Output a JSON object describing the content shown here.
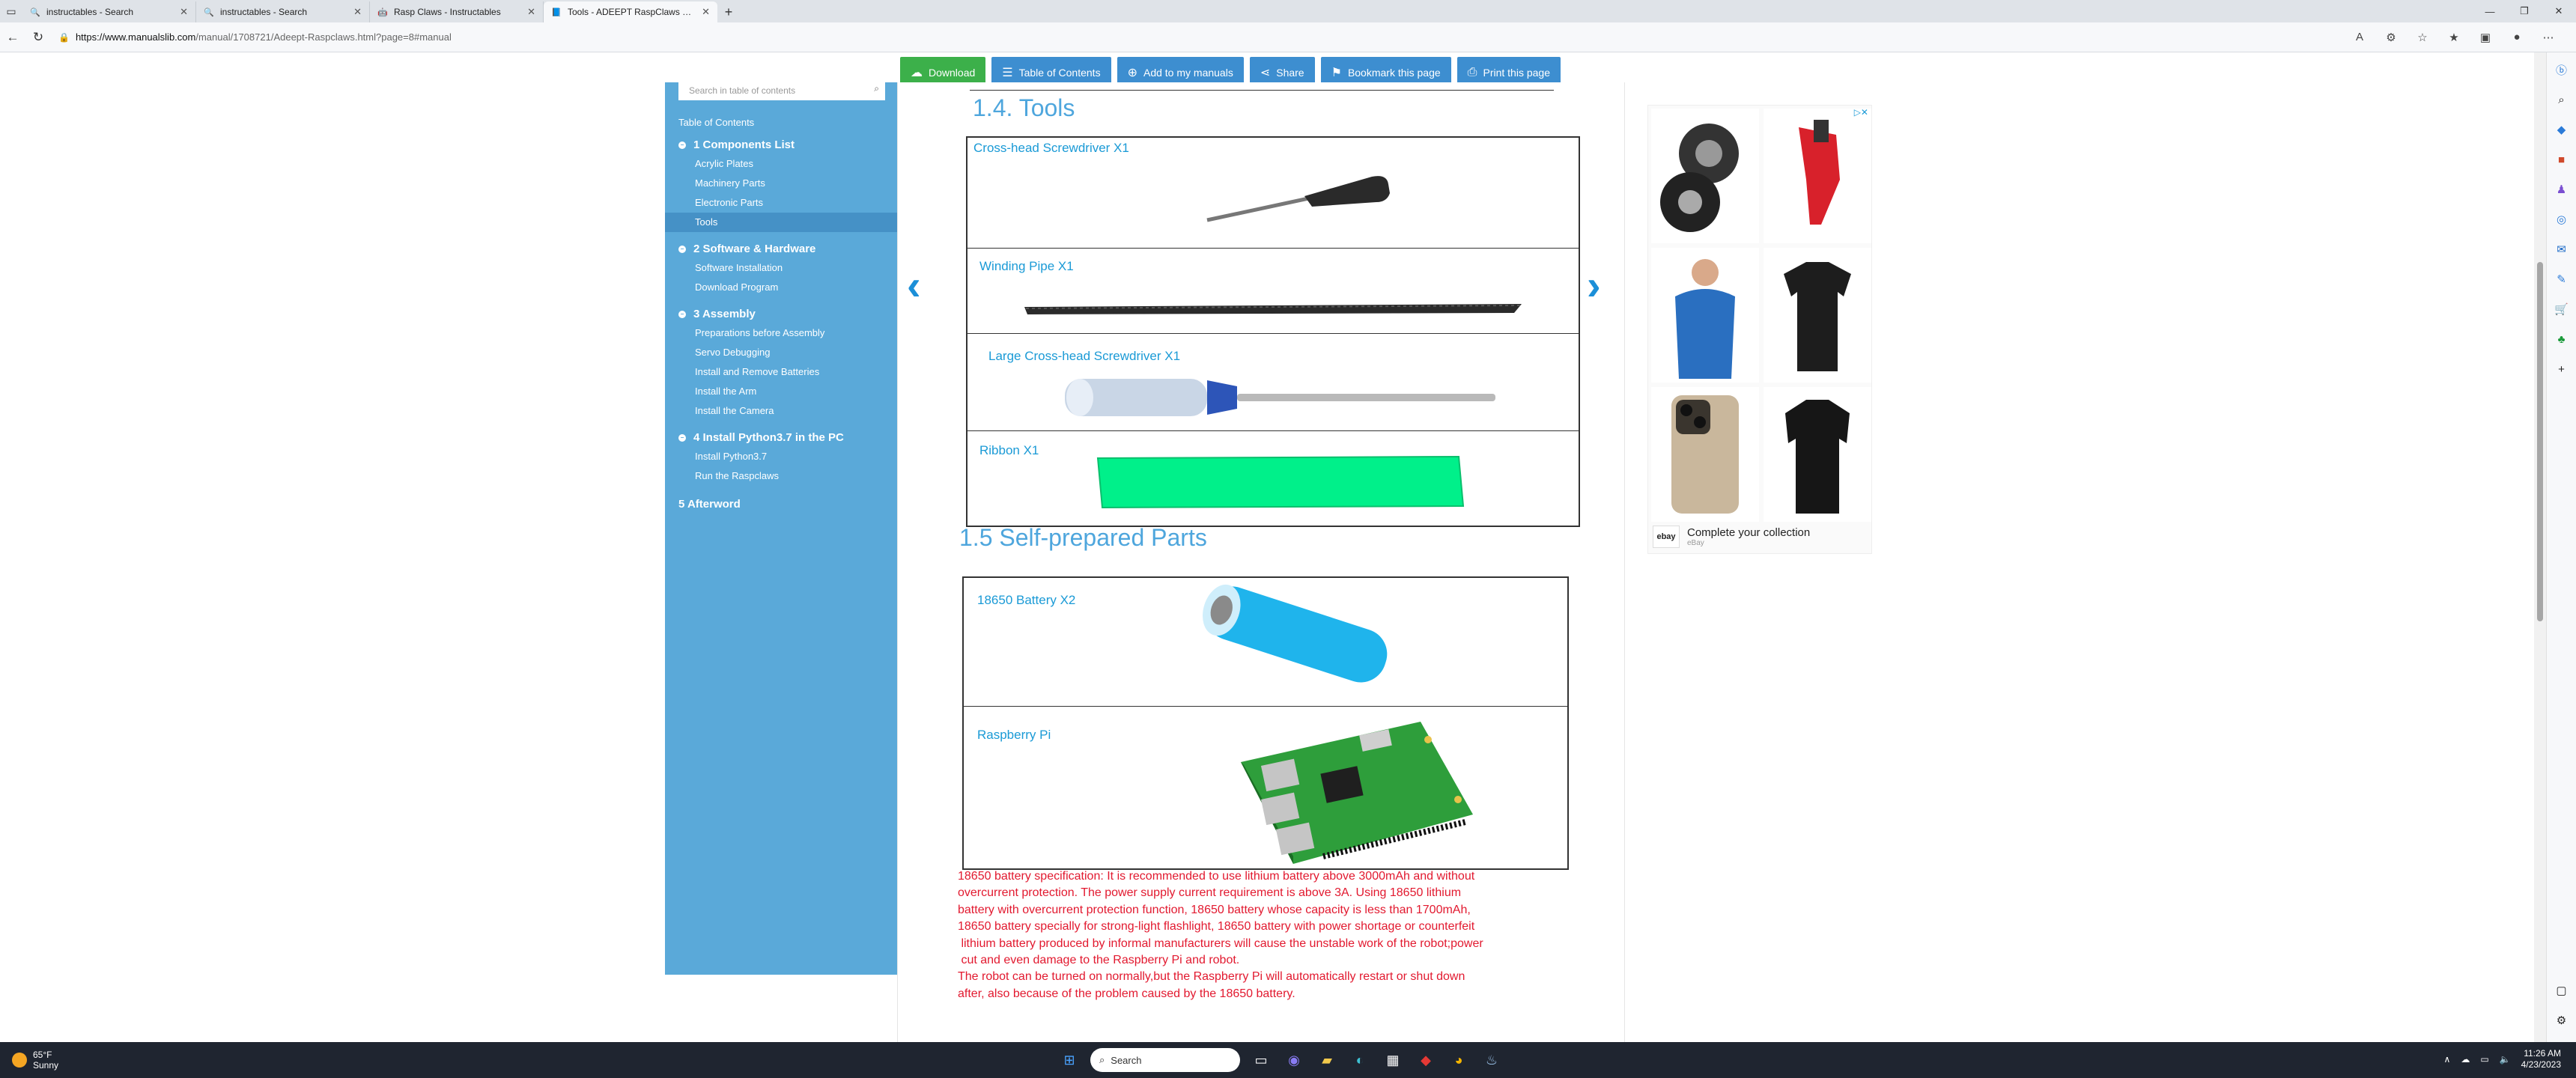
{
  "tabs": [
    {
      "title": "instructables - Search",
      "icon": "🔍"
    },
    {
      "title": "instructables - Search",
      "icon": "🔍"
    },
    {
      "title": "Rasp Claws - Instructables",
      "icon": "🤖"
    },
    {
      "title": "Tools - ADEEPT RaspClaws User M",
      "icon": "📘"
    }
  ],
  "address": {
    "host": "https://www.manualslib.com",
    "path": "/manual/1708721/Adeept-Raspclaws.html?page=8#manual"
  },
  "toolbar": {
    "download": "Download",
    "toc": "Table of Contents",
    "add": "Add to my manuals",
    "share": "Share",
    "bookmark": "Bookmark this page",
    "print": "Print this page"
  },
  "toc": {
    "search_placeholder": "Search in table of contents",
    "title": "Table of Contents",
    "s1": "1 Components List",
    "s1_items": [
      "Acrylic Plates",
      "Machinery Parts",
      "Electronic Parts",
      "Tools"
    ],
    "s2": "2 Software & Hardware",
    "s2_items": [
      "Software Installation",
      "Download Program"
    ],
    "s3": "3 Assembly",
    "s3_items": [
      "Preparations before Assembly",
      "Servo Debugging",
      "Install and Remove Batteries",
      "Install the Arm",
      "Install the Camera"
    ],
    "s4": "4 Install Python3.7 in the PC",
    "s4_items": [
      "Install Python3.7",
      "Run the Raspclaws"
    ],
    "s5": "5 Afterword"
  },
  "content": {
    "h_tools": "1.4. Tools",
    "tool1": "Cross-head Screwdriver X1",
    "tool2": "Winding Pipe X1",
    "tool3": "Large Cross-head Screwdriver X1",
    "tool4": "Ribbon X1",
    "h_self": "1.5 Self-prepared Parts",
    "part1": "18650 Battery X2",
    "part2": "Raspberry Pi",
    "warning": [
      "18650 battery specification: It is recommended to use lithium battery above 3000mAh and without",
      "overcurrent protection. The power supply current requirement is above 3A. Using 18650 lithium",
      "battery with overcurrent protection function, 18650 battery whose capacity is less than 1700mAh,",
      "18650 battery specially for strong-light flashlight, 18650 battery with power shortage or counterfeit",
      " lithium battery produced by informal manufacturers will cause the unstable work of the robot;power",
      " cut and even damage to the Raspberry Pi and robot.",
      "The robot can be turned on normally,but the Raspberry Pi will automatically restart or shut down",
      "after, also because of the problem caused by the 18650 battery."
    ]
  },
  "ad": {
    "text": "Complete your collection",
    "sub": "eBay",
    "brand": "ebay"
  },
  "taskbar": {
    "temp": "65°F",
    "cond": "Sunny",
    "search": "Search",
    "time": "11:26 AM",
    "date": "4/23/2023"
  }
}
